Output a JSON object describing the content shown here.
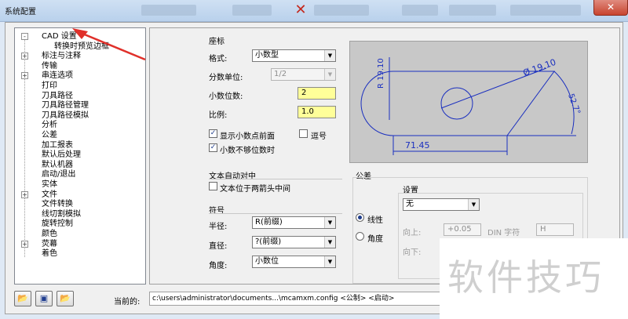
{
  "window": {
    "title": "系统配置",
    "close_label": "✕"
  },
  "tree": {
    "items": [
      {
        "label": "CAD 设置",
        "expander": "-",
        "child": false
      },
      {
        "label": "转换时预览边框",
        "expander": "",
        "child": true
      },
      {
        "label": "标注与注释",
        "expander": "+",
        "child": false
      },
      {
        "label": "传输",
        "expander": "",
        "child": false
      },
      {
        "label": "串连选项",
        "expander": "+",
        "child": false
      },
      {
        "label": "打印",
        "expander": "",
        "child": false
      },
      {
        "label": "刀具路径",
        "expander": "",
        "child": false
      },
      {
        "label": "刀具路径管理",
        "expander": "",
        "child": false
      },
      {
        "label": "刀具路径模拟",
        "expander": "",
        "child": false
      },
      {
        "label": "分析",
        "expander": "",
        "child": false
      },
      {
        "label": "公差",
        "expander": "",
        "child": false
      },
      {
        "label": "加工报表",
        "expander": "",
        "child": false
      },
      {
        "label": "默认后处理",
        "expander": "",
        "child": false
      },
      {
        "label": "默认机器",
        "expander": "",
        "child": false
      },
      {
        "label": "启动/退出",
        "expander": "",
        "child": false
      },
      {
        "label": "实体",
        "expander": "",
        "child": false
      },
      {
        "label": "文件",
        "expander": "+",
        "child": false
      },
      {
        "label": "文件转换",
        "expander": "",
        "child": false
      },
      {
        "label": "线切割模拟",
        "expander": "",
        "child": false
      },
      {
        "label": "旋转控制",
        "expander": "",
        "child": false
      },
      {
        "label": "颜色",
        "expander": "",
        "child": false
      },
      {
        "label": "荧幕",
        "expander": "+",
        "child": false
      },
      {
        "label": "着色",
        "expander": "",
        "child": false
      }
    ]
  },
  "coords": {
    "title": "座标",
    "format_label": "格式:",
    "format_value": "小数型",
    "fraction_label": "分数单位:",
    "fraction_value": "1/2",
    "decimals_label": "小数位数:",
    "decimals_value": "2",
    "scale_label": "比例:",
    "scale_value": "1.0",
    "show_leading_label": "显示小数点前面",
    "comma_label": "逗号",
    "trailing_label": "小数不够位数时"
  },
  "text_center": {
    "title": "文本自动对中",
    "between_arrows_label": "文本位于两箭头中间"
  },
  "symbols": {
    "title": "符号",
    "radius_label": "半径:",
    "radius_value": "R(前缀)",
    "diameter_label": "直径:",
    "diameter_value": "?(前缀)",
    "angle_label": "角度:",
    "angle_value": "小数位"
  },
  "tolerance": {
    "title": "公差",
    "linear_label": "线性",
    "angle_label": "角度",
    "settings_title": "设置",
    "settings_value": "无",
    "up_label": "向上:",
    "up_value": "+0.05",
    "din_label": "DIN 字符",
    "din_value": "H",
    "down_label": "向下:"
  },
  "preview": {
    "radius_text": "R 19.10",
    "diameter_text": "Ø 19.10",
    "angle_text": "52.7°",
    "length_text": "71.45",
    "line_color": "#1a2fbf"
  },
  "footer": {
    "current_label": "当前的:",
    "current_path": "c:\\users\\administrator\\documents...\\mcamxm.config <公制> <启动>"
  },
  "watermark": {
    "text": "软件技巧"
  },
  "colors": {
    "highlight_field": "#ffff99",
    "annotation_arrow": "#e0302a"
  }
}
